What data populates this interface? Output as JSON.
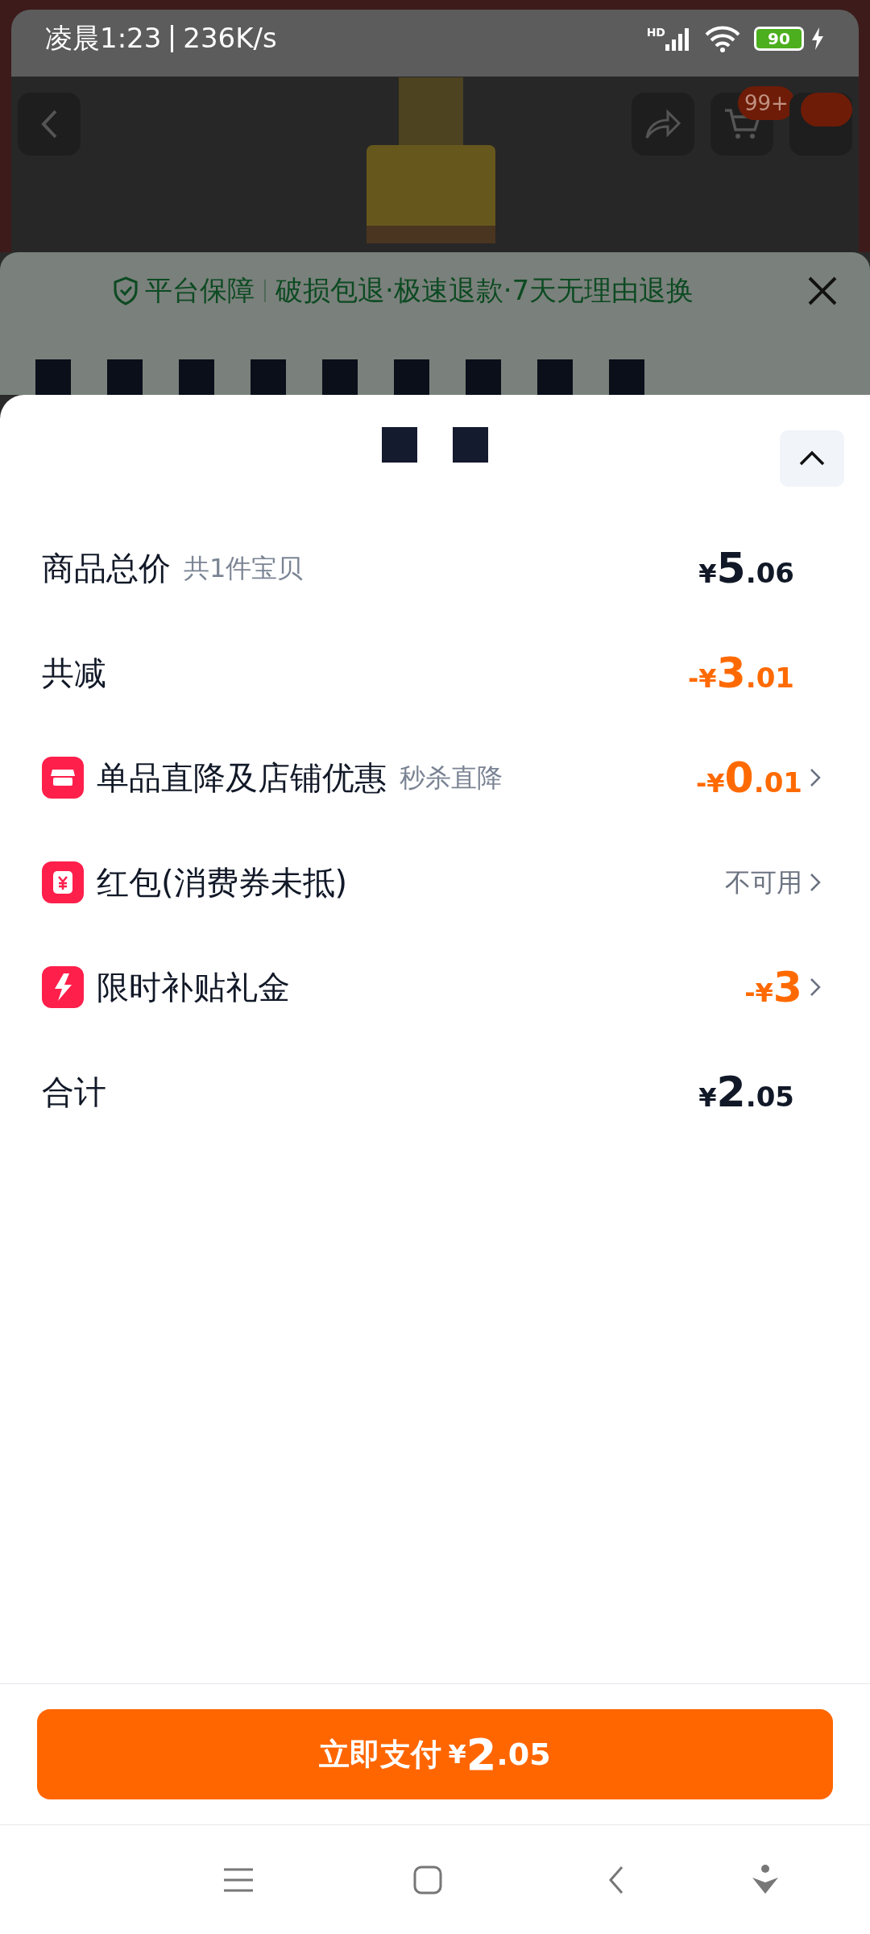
{
  "status_bar": {
    "time": "凌晨1:23",
    "speed": "236K/s",
    "network": "HD",
    "battery": "90"
  },
  "product_header": {
    "cart_badge": "99+"
  },
  "guarantee": {
    "label": "平台保障",
    "text": "破损包退·极速退款·7天无理由退换"
  },
  "sheet": {
    "rows": [
      {
        "kind": "summary",
        "label": "商品总价",
        "note": "共1件宝贝",
        "highlight": false,
        "amount": {
          "prefix": "¥",
          "integer": "5",
          "decimal": ".06"
        }
      },
      {
        "kind": "summary",
        "label": "共减",
        "highlight": true,
        "amount": {
          "prefix": "-¥",
          "integer": "3",
          "decimal": ".01"
        }
      },
      {
        "kind": "store",
        "label": "单品直降及店铺优惠",
        "note": "秒杀直降",
        "highlight": true,
        "amount": {
          "prefix": "-¥",
          "integer": "0",
          "decimal": ".01"
        }
      },
      {
        "kind": "coupon",
        "label": "红包(消费券未抵)",
        "highlight": false,
        "status": "不可用"
      },
      {
        "kind": "subsidy",
        "label": "限时补贴礼金",
        "highlight": true,
        "amount": {
          "prefix": "-¥",
          "integer": "3"
        }
      },
      {
        "kind": "summary",
        "label": "合计",
        "highlight": false,
        "amount": {
          "prefix": "¥",
          "integer": "2",
          "decimal": ".05"
        }
      }
    ]
  },
  "pay_button": {
    "label": "立即支付",
    "prefix": "¥",
    "integer": "2",
    "decimal": ".05"
  }
}
